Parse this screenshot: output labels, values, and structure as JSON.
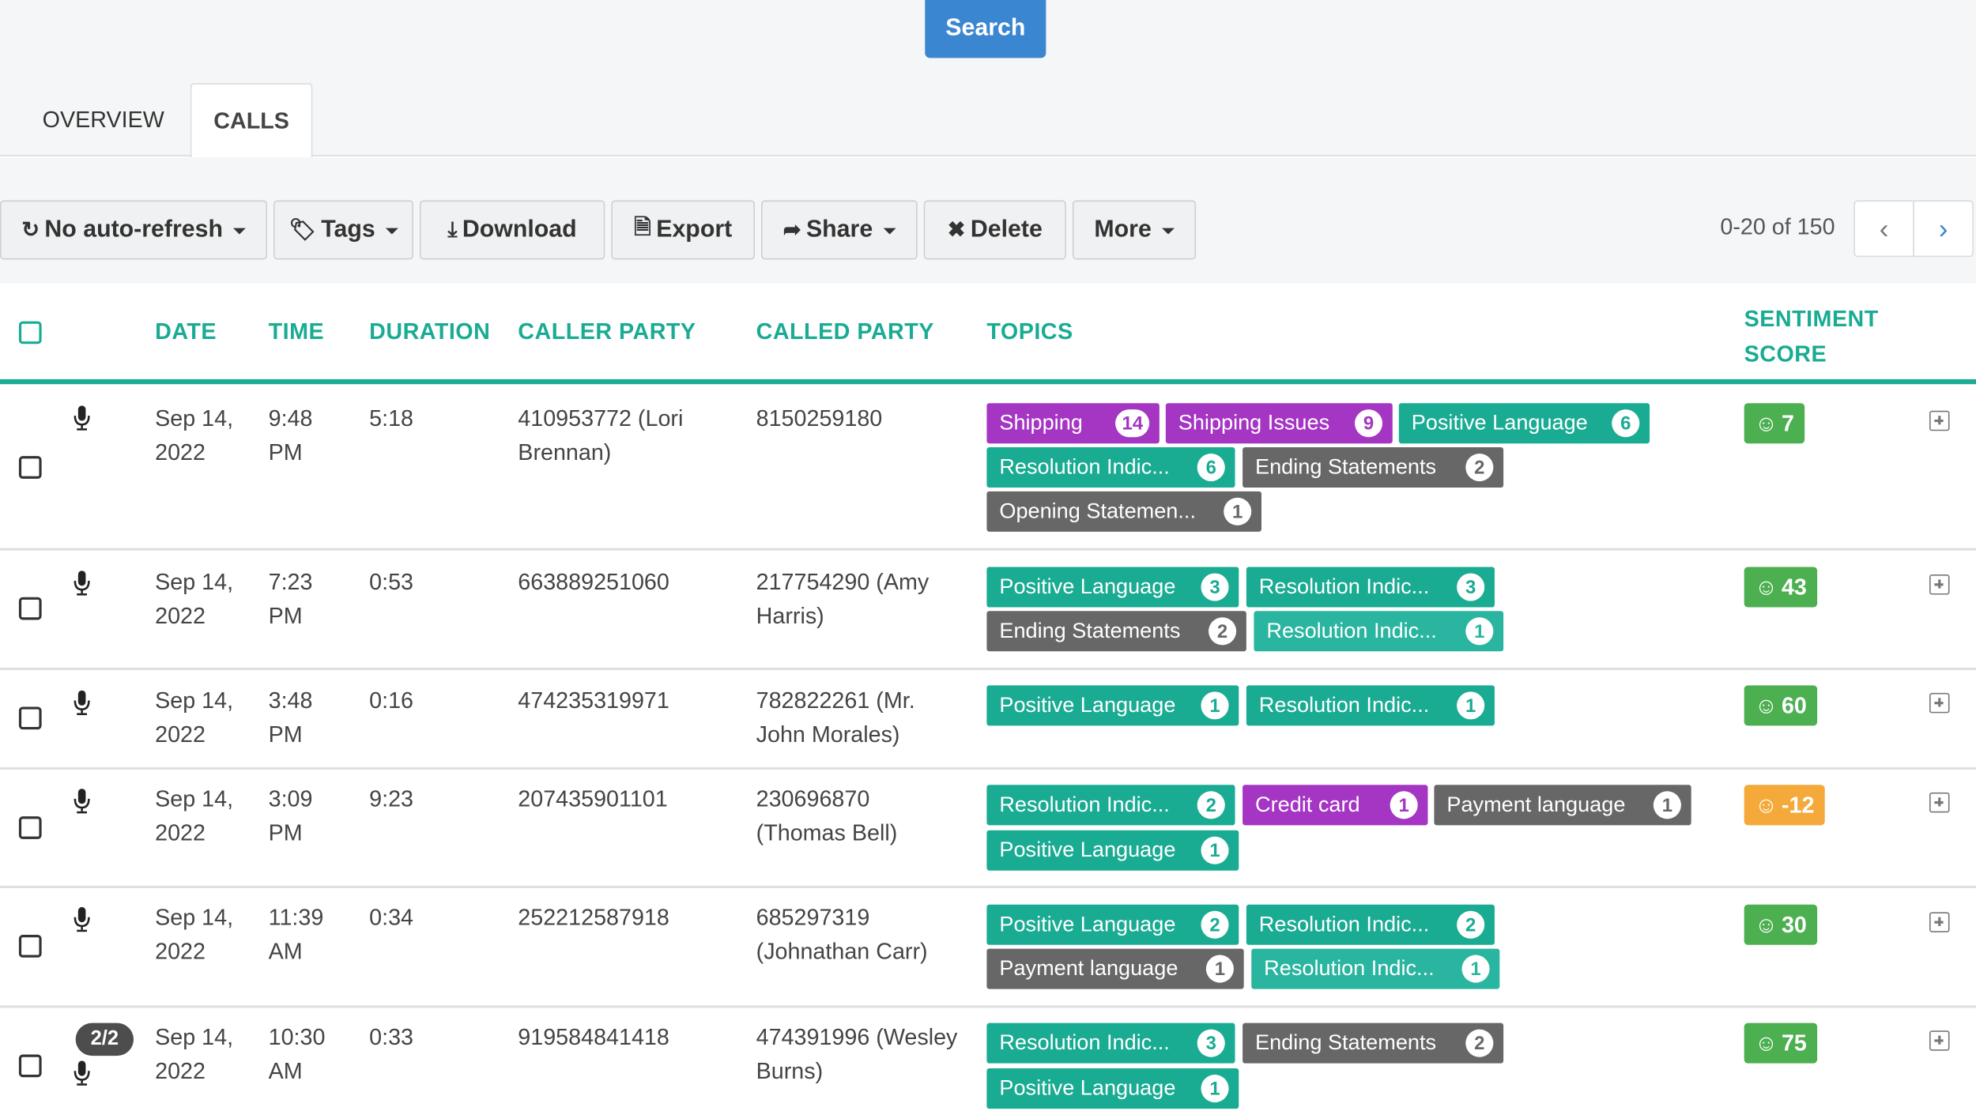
{
  "search_label": "Search",
  "tabs": [
    {
      "label": "OVERVIEW",
      "active": false
    },
    {
      "label": "CALLS",
      "active": true
    }
  ],
  "toolbar": {
    "auto_refresh": "No auto-refresh",
    "tags": "Tags",
    "download": "Download",
    "export": "Export",
    "share": "Share",
    "delete": "Delete",
    "more": "More"
  },
  "pager": {
    "text": "0-20 of 150"
  },
  "headers": {
    "date": "DATE",
    "time": "TIME",
    "duration": "DURATION",
    "caller": "CALLER PARTY",
    "called": "CALLED PARTY",
    "topics": "TOPICS",
    "sentiment_1": "SENTIMENT",
    "sentiment_2": "SCORE"
  },
  "colors": {
    "accent": "#1aab93",
    "search": "#3b86d1",
    "purple": "#a535c3",
    "gray": "#676767",
    "positive": "#4caf50",
    "negative": "#f4a93a"
  },
  "rows": [
    {
      "date1": "Sep 14,",
      "date2": "2022",
      "time1": "9:48",
      "time2": "PM",
      "duration": "5:18",
      "caller1": "410953772 (Lori",
      "caller2": "Brennan)",
      "called1": "8150259180",
      "called2": "",
      "badge": "",
      "topics": [
        {
          "label": "Shipping",
          "count": "14"
        },
        {
          "label": "Shipping Issues",
          "count": "9"
        },
        {
          "label": "Positive Language",
          "count": "6"
        },
        {
          "label": "Resolution Indic...",
          "count": "6"
        },
        {
          "label": "Ending Statements",
          "count": "2"
        },
        {
          "label": "Opening Statemen...",
          "count": "1"
        }
      ],
      "sentiment": "7"
    },
    {
      "date1": "Sep 14,",
      "date2": "2022",
      "time1": "7:23",
      "time2": "PM",
      "duration": "0:53",
      "caller1": "663889251060",
      "caller2": "",
      "called1": "217754290 (Amy",
      "called2": "Harris)",
      "badge": "",
      "topics": [
        {
          "label": "Positive Language",
          "count": "3"
        },
        {
          "label": "Resolution Indic...",
          "count": "3"
        },
        {
          "label": "Ending Statements",
          "count": "2"
        },
        {
          "label": "Resolution Indic...",
          "count": "1"
        }
      ],
      "sentiment": "43"
    },
    {
      "date1": "Sep 14,",
      "date2": "2022",
      "time1": "3:48",
      "time2": "PM",
      "duration": "0:16",
      "caller1": "474235319971",
      "caller2": "",
      "called1": "782822261 (Mr.",
      "called2": "John Morales)",
      "badge": "",
      "topics": [
        {
          "label": "Positive Language",
          "count": "1"
        },
        {
          "label": "Resolution Indic...",
          "count": "1"
        }
      ],
      "sentiment": "60"
    },
    {
      "date1": "Sep 14,",
      "date2": "2022",
      "time1": "3:09",
      "time2": "PM",
      "duration": "9:23",
      "caller1": "207435901101",
      "caller2": "",
      "called1": "230696870",
      "called2": "(Thomas Bell)",
      "badge": "",
      "topics": [
        {
          "label": "Resolution Indic...",
          "count": "2"
        },
        {
          "label": "Credit card",
          "count": "1"
        },
        {
          "label": "Payment language",
          "count": "1"
        },
        {
          "label": "Positive Language",
          "count": "1"
        }
      ],
      "sentiment": "-12"
    },
    {
      "date1": "Sep 14,",
      "date2": "2022",
      "time1": "11:39",
      "time2": "AM",
      "duration": "0:34",
      "caller1": "252212587918",
      "caller2": "",
      "called1": "685297319",
      "called2": "(Johnathan Carr)",
      "badge": "",
      "topics": [
        {
          "label": "Positive Language",
          "count": "2"
        },
        {
          "label": "Resolution Indic...",
          "count": "2"
        },
        {
          "label": "Payment language",
          "count": "1"
        },
        {
          "label": "Resolution Indic...",
          "count": "1"
        }
      ],
      "sentiment": "30"
    },
    {
      "date1": "Sep 14,",
      "date2": "2022",
      "time1": "10:30",
      "time2": "AM",
      "duration": "0:33",
      "caller1": "919584841418",
      "caller2": "",
      "called1": "474391996 (Wesley",
      "called2": "Burns)",
      "badge": "2/2",
      "topics": [
        {
          "label": "Resolution Indic...",
          "count": "3"
        },
        {
          "label": "Ending Statements",
          "count": "2"
        },
        {
          "label": "Positive Language",
          "count": "1"
        }
      ],
      "sentiment": "75"
    }
  ]
}
